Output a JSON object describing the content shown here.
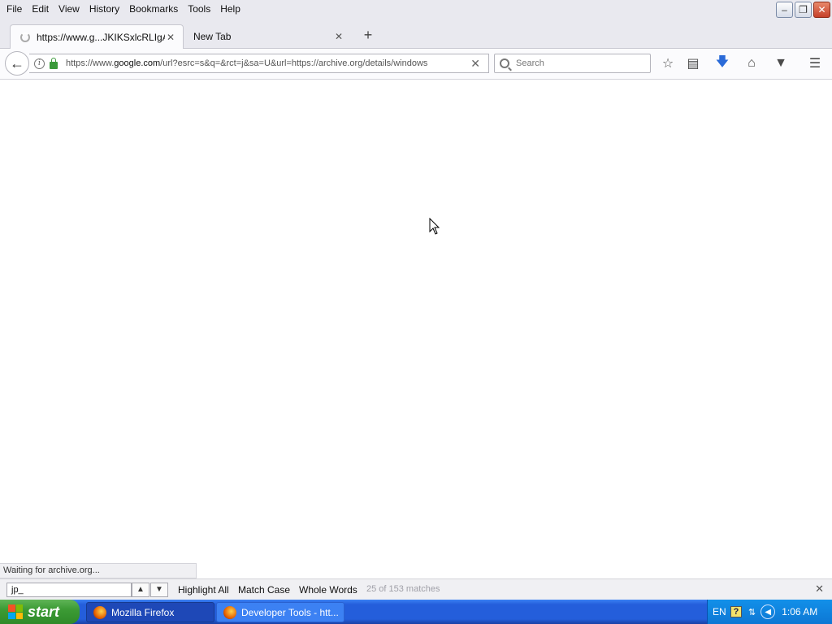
{
  "menubar": {
    "items": [
      "File",
      "Edit",
      "View",
      "History",
      "Bookmarks",
      "Tools",
      "Help"
    ]
  },
  "tabs": [
    {
      "label": "https://www.g...JKIKSxlcRLIgA",
      "active": true
    },
    {
      "label": "New Tab",
      "active": false
    }
  ],
  "navbar": {
    "url_host_prefix": "https://www.",
    "url_host": "google.com",
    "url_rest": "/url?esrc=s&q=&rct=j&sa=U&url=https://archive.org/details/windows",
    "search_placeholder": "Search"
  },
  "status": {
    "text": "Waiting for archive.org..."
  },
  "findbar": {
    "query": "jp_",
    "highlight_all": "Highlight All",
    "match_case": "Match Case",
    "whole_words": "Whole Words",
    "match_status": "25 of 153 matches"
  },
  "taskbar": {
    "start_label": "start",
    "tasks": [
      {
        "label": "Mozilla Firefox",
        "active": true
      },
      {
        "label": "Developer Tools - htt...",
        "active": false
      }
    ],
    "language": "EN",
    "clock": "1:06 AM"
  },
  "colors": {
    "taskbar_blue": "#245edb",
    "start_green": "#3c9b35",
    "lock_green": "#3a9a3a",
    "download_arrow": "#2a6ad8"
  }
}
